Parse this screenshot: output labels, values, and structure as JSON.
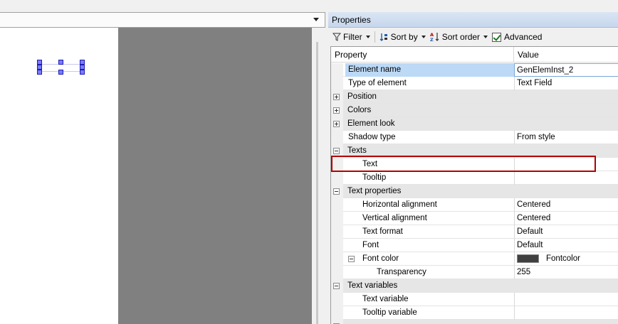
{
  "panel": {
    "title": "Properties"
  },
  "toolbar": {
    "filter": "Filter",
    "sort_by": "Sort by",
    "sort_order": "Sort order",
    "advanced": "Advanced",
    "advanced_checked": true
  },
  "grid": {
    "col_property": "Property",
    "col_value": "Value",
    "rows": [
      {
        "name": "Element name",
        "value": "GenElemInst_2",
        "type": "prop",
        "indent": 1,
        "selected": true
      },
      {
        "name": "Type of element",
        "value": "Text Field",
        "type": "prop",
        "indent": 1
      },
      {
        "name": "Position",
        "value": "",
        "type": "cat",
        "expander": "plus"
      },
      {
        "name": "Colors",
        "value": "",
        "type": "cat",
        "expander": "plus"
      },
      {
        "name": "Element look",
        "value": "",
        "type": "cat",
        "expander": "plus"
      },
      {
        "name": "Shadow type",
        "value": "From style",
        "type": "prop",
        "indent": 1
      },
      {
        "name": "Texts",
        "value": "",
        "type": "cat",
        "expander": "minus"
      },
      {
        "name": "Text",
        "value": "",
        "type": "prop",
        "indent": 2
      },
      {
        "name": "Tooltip",
        "value": "",
        "type": "prop",
        "indent": 2
      },
      {
        "name": "Text properties",
        "value": "",
        "type": "cat",
        "expander": "minus"
      },
      {
        "name": "Horizontal alignment",
        "value": "Centered",
        "type": "prop",
        "indent": 2
      },
      {
        "name": "Vertical alignment",
        "value": "Centered",
        "type": "prop",
        "indent": 2
      },
      {
        "name": "Text format",
        "value": "Default",
        "type": "prop",
        "indent": 2
      },
      {
        "name": "Font",
        "value": "Default",
        "type": "prop",
        "indent": 2
      },
      {
        "name": "Font color",
        "value": "Fontcolor",
        "type": "prop",
        "indent": 2,
        "expander": "minus",
        "swatch": "#404040"
      },
      {
        "name": "Transparency",
        "value": "255",
        "type": "prop",
        "indent": 3
      },
      {
        "name": "Text variables",
        "value": "",
        "type": "cat",
        "expander": "minus"
      },
      {
        "name": "Text variable",
        "value": "",
        "type": "prop",
        "indent": 2
      },
      {
        "name": "Tooltip variable",
        "value": "",
        "type": "prop",
        "indent": 2
      },
      {
        "name": "",
        "value": "",
        "type": "cat",
        "expander": "plus"
      }
    ]
  },
  "colors": {
    "highlight": "#b40000",
    "selection": "#bcd9f5",
    "handle": "#7b7bff",
    "canvas_grey": "#808080"
  }
}
